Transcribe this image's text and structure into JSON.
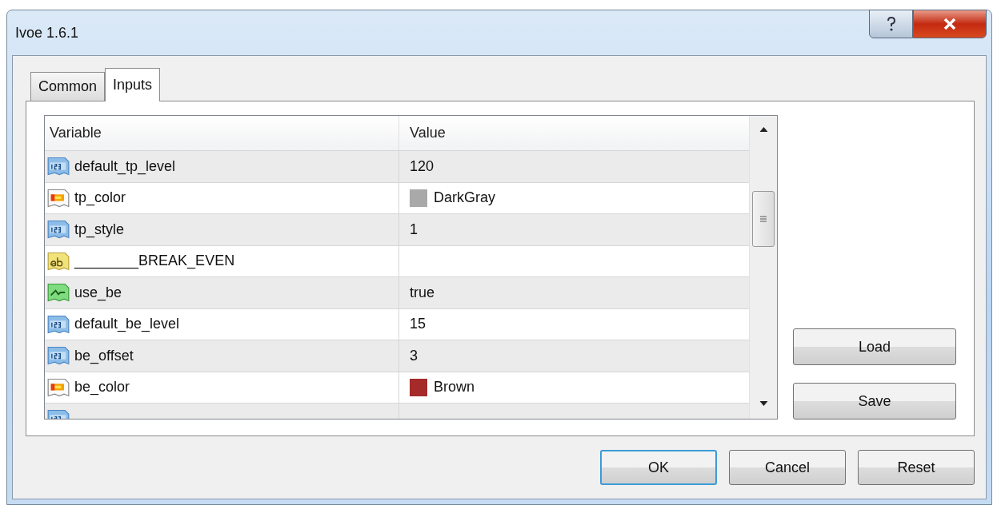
{
  "window": {
    "title": "Ivoe 1.6.1"
  },
  "tabs": [
    {
      "label": "Common",
      "selected": false
    },
    {
      "label": "Inputs",
      "selected": true
    }
  ],
  "table": {
    "columns": [
      "Variable",
      "Value"
    ],
    "rows": [
      {
        "kind": "number",
        "variable": "default_tp_level",
        "value": "120"
      },
      {
        "kind": "color",
        "variable": "tp_color",
        "value": "DarkGray",
        "color": "#a9a9a9"
      },
      {
        "kind": "number",
        "variable": "tp_style",
        "value": "1"
      },
      {
        "kind": "text",
        "variable": "________BREAK_EVEN",
        "value": ""
      },
      {
        "kind": "bool",
        "variable": "use_be",
        "value": "true"
      },
      {
        "kind": "number",
        "variable": "default_be_level",
        "value": "15"
      },
      {
        "kind": "number",
        "variable": "be_offset",
        "value": "3"
      },
      {
        "kind": "color",
        "variable": "be_color",
        "value": "Brown",
        "color": "#a52a2a"
      },
      {
        "kind": "number"
      }
    ]
  },
  "side_buttons": [
    "Load",
    "Save"
  ],
  "buttons": [
    {
      "label": "OK",
      "default": true
    },
    {
      "label": "Cancel",
      "default": false
    },
    {
      "label": "Reset",
      "default": false
    }
  ]
}
